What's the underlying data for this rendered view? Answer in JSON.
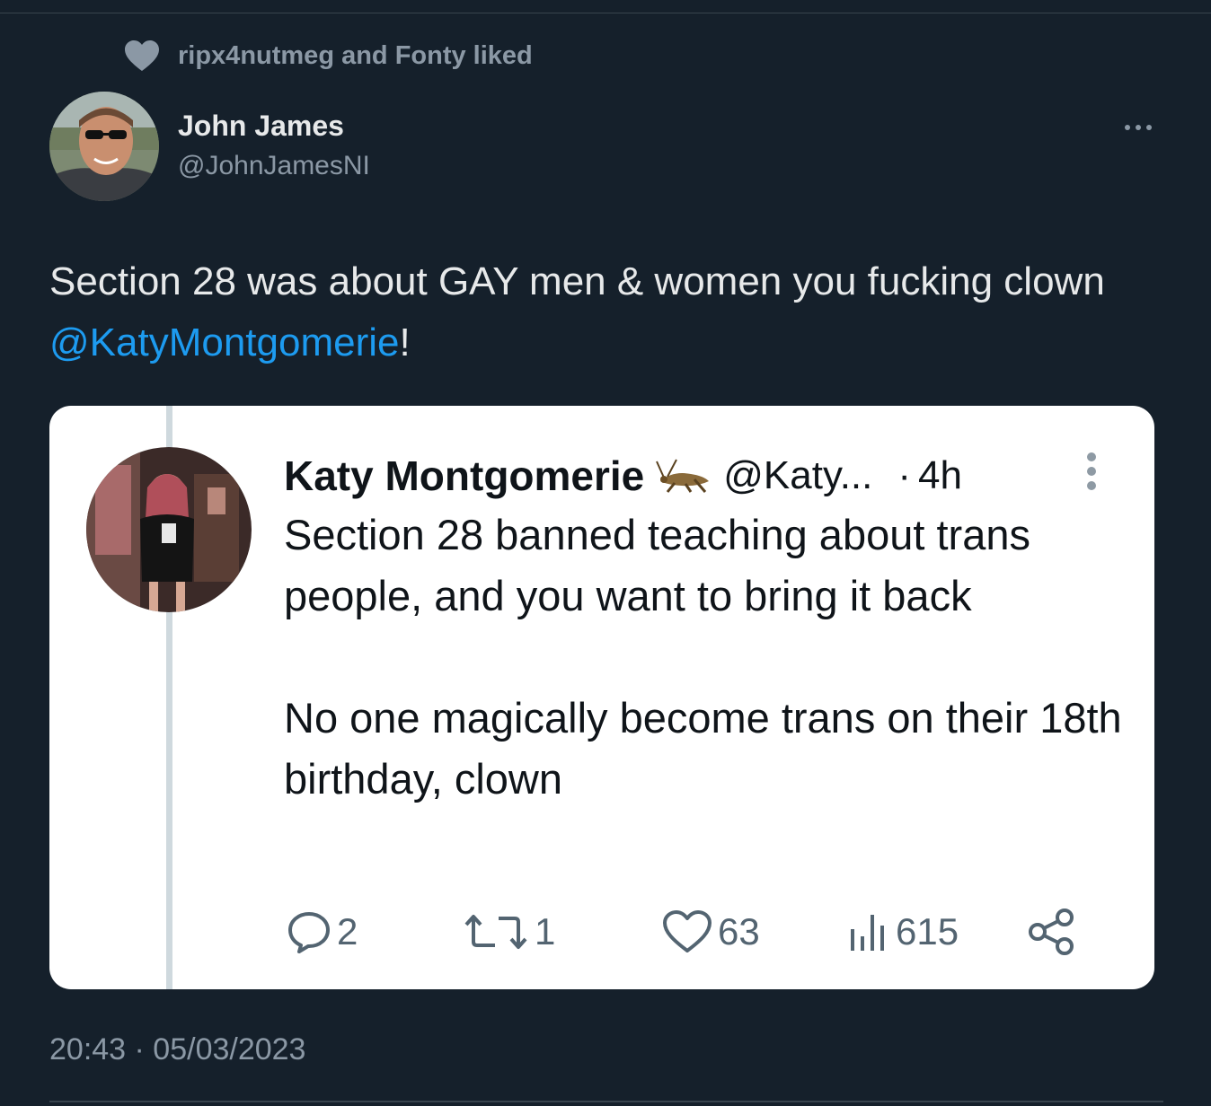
{
  "social_context": {
    "icon": "heart-icon",
    "text": "ripx4nutmeg and Fonty liked"
  },
  "tweet": {
    "author_name": "John James",
    "author_handle": "@JohnJamesNI",
    "text_before": "Section 28 was about GAY men & women you fucking clown ",
    "mention": "@KatyMontgomerie",
    "text_after": "!",
    "timestamp": "20:43 · 05/03/2023"
  },
  "quoted_tweet": {
    "author_name": "Katy Montgomerie",
    "badge_icon": "cricket-icon",
    "handle": "@Katy...",
    "separator": "·",
    "time": "4h",
    "paragraph_1": "Section 28 banned teaching about trans people, and you want to bring it back",
    "paragraph_2": "No one magically become trans on their 18th birthday, clown",
    "replies": "2",
    "retweets": "1",
    "likes": "63",
    "views": "615"
  },
  "colors": {
    "background": "#15202b",
    "link": "#1d9bf0",
    "secondary_text": "#8b98a5",
    "card_background": "#ffffff"
  }
}
